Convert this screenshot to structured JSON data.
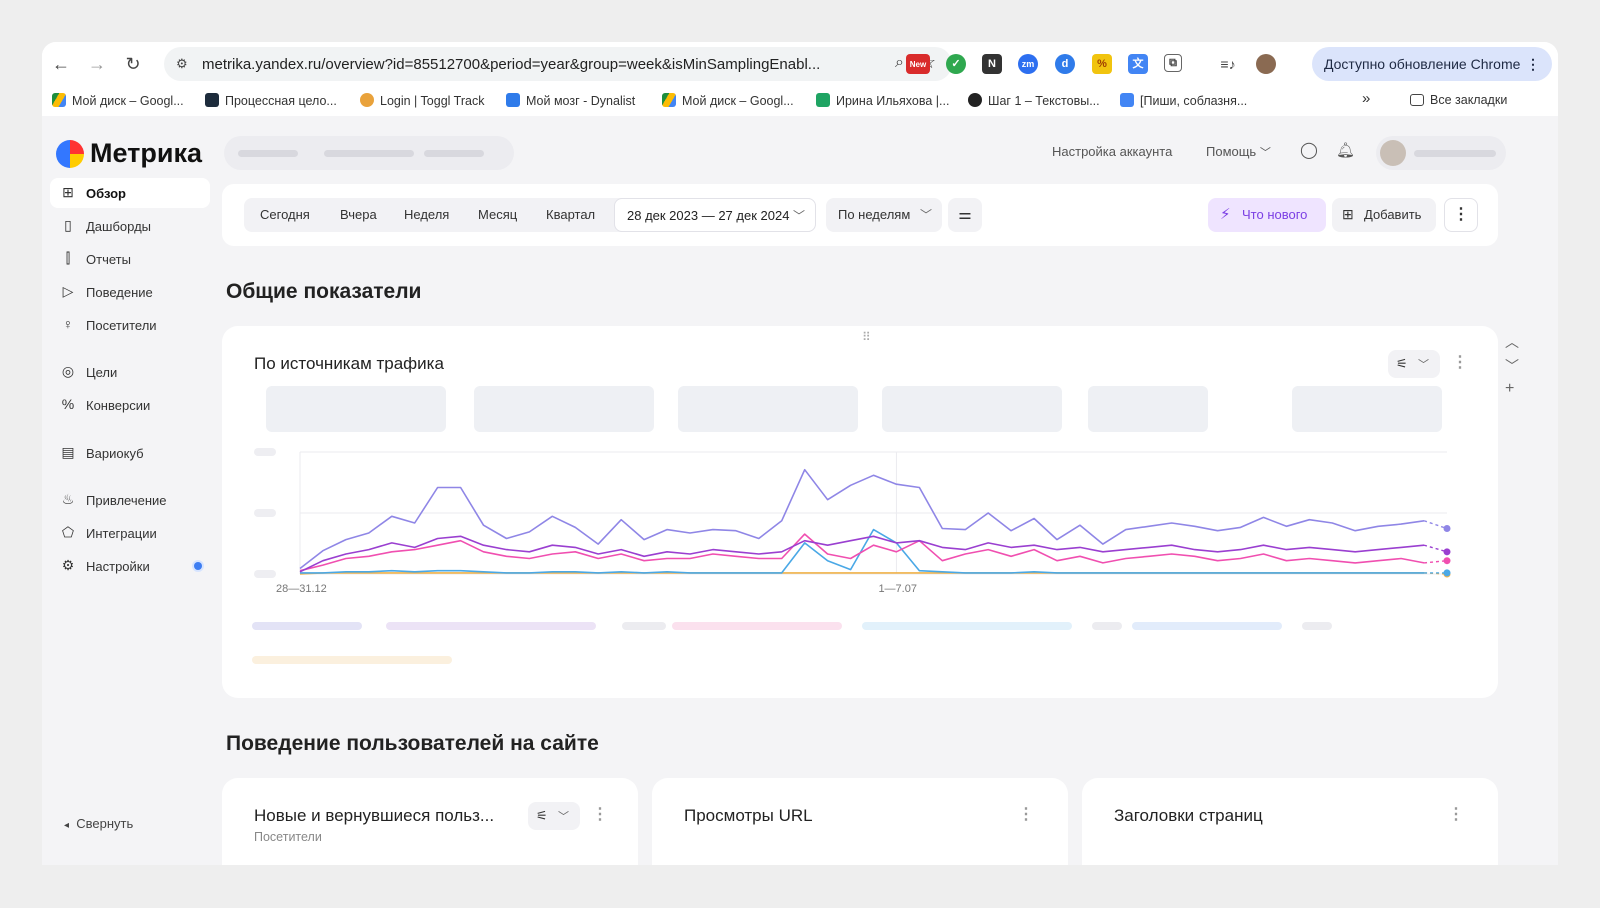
{
  "browser": {
    "url": "metrika.yandex.ru/overview?id=85512700&period=year&group=week&isMinSamplingEnabl...",
    "update_label": "Доступно обновление Chrome",
    "extensions": [
      "toggl-new-icon",
      "chrome-check-icon",
      "notion-icon",
      "zoom-icon",
      "dynalist-icon",
      "percent-icon",
      "translate-icon",
      "puzzle-icon",
      "media-icon",
      "profile-avatar-icon"
    ],
    "new_badge": "New",
    "bookmarks": [
      "Мой диск – Googl...",
      "Процессная цело...",
      "Login | Toggl Track",
      "Мой мозг - Dynalist",
      "Мой диск – Googl...",
      "Ирина Ильяхова |...",
      "Шаг 1 – Текстовы...",
      "[Пиши, соблазня..."
    ],
    "bookmarks_more": "»",
    "all_bookmarks": "Все закладки"
  },
  "header": {
    "logo": "Метрика",
    "account_settings": "Настройка аккаунта",
    "help": "Помощь"
  },
  "sidebar": {
    "items": [
      {
        "label": "Обзор",
        "icon": "grid-icon",
        "glyph": "⊞"
      },
      {
        "label": "Дашборды",
        "icon": "dashboards-icon",
        "glyph": "▯"
      },
      {
        "label": "Отчеты",
        "icon": "reports-icon",
        "glyph": "⫿"
      },
      {
        "label": "Поведение",
        "icon": "play-icon",
        "glyph": "▷"
      },
      {
        "label": "Посетители",
        "icon": "person-icon",
        "glyph": "♀"
      },
      {
        "label": "Цели",
        "icon": "target-icon",
        "glyph": "◎"
      },
      {
        "label": "Конверсии",
        "icon": "percent-icon",
        "glyph": "%"
      },
      {
        "label": "Вариокуб",
        "icon": "cube-icon",
        "glyph": "▤"
      },
      {
        "label": "Привлечение",
        "icon": "flame-icon",
        "glyph": "♨"
      },
      {
        "label": "Интеграции",
        "icon": "integration-icon",
        "glyph": "⬠"
      },
      {
        "label": "Настройки",
        "icon": "gear-icon",
        "glyph": "⚙"
      }
    ],
    "collapse": "Свернуть"
  },
  "filters": {
    "periods": [
      "Сегодня",
      "Вчера",
      "Неделя",
      "Месяц",
      "Квартал"
    ],
    "date_range": "28 дек 2023 — 27 дек 2024",
    "group_by": "По неделям",
    "whats_new": "Что нового",
    "add": "Добавить"
  },
  "sections": {
    "general": "Общие показатели",
    "behavior": "Поведение пользователей на сайте"
  },
  "traffic_card": {
    "title": "По источникам трафика",
    "x_ticks": [
      "28—31.12",
      "1—7.07"
    ]
  },
  "behavior_cards": [
    {
      "title": "Новые и вернувшиеся польз...",
      "subtitle": "Посетители"
    },
    {
      "title": "Просмотры URL",
      "subtitle": ""
    },
    {
      "title": "Заголовки страниц",
      "subtitle": ""
    }
  ],
  "colors": {
    "purple": "#8f86e6",
    "violet": "#9a3fd0",
    "pink": "#f04fb0",
    "blue": "#4aa8e6",
    "orange": "#f0b24a",
    "green": "#5fcf7f",
    "accent": "#7b3fe4"
  },
  "chart_data": {
    "type": "line",
    "title": "По источникам трафика",
    "xlabel": "",
    "ylabel": "",
    "x_ticks_visible": [
      "28—31.12",
      "1—7.07"
    ],
    "grid": true,
    "series": [
      {
        "color": "#8f86e6",
        "values": [
          5,
          21,
          31,
          37,
          52,
          46,
          78,
          78,
          44,
          32,
          38,
          52,
          42,
          27,
          49,
          31,
          40,
          37,
          40,
          39,
          32,
          48,
          94,
          67,
          80,
          89,
          81,
          78,
          41,
          40,
          55,
          39,
          50,
          31,
          44,
          27,
          40,
          43,
          46,
          43,
          39,
          42,
          51,
          43,
          49,
          46,
          39,
          43,
          45,
          48,
          41
        ]
      },
      {
        "color": "#9a3fd0",
        "values": [
          2,
          12,
          18,
          22,
          28,
          24,
          32,
          34,
          26,
          22,
          20,
          26,
          24,
          18,
          22,
          16,
          20,
          18,
          22,
          20,
          18,
          20,
          30,
          26,
          30,
          34,
          28,
          30,
          24,
          22,
          28,
          24,
          26,
          22,
          24,
          20,
          22,
          24,
          26,
          22,
          20,
          22,
          26,
          22,
          24,
          22,
          20,
          22,
          24,
          26,
          20
        ]
      },
      {
        "color": "#f04fb0",
        "values": [
          3,
          8,
          14,
          16,
          20,
          22,
          26,
          30,
          20,
          16,
          14,
          18,
          20,
          14,
          18,
          12,
          14,
          14,
          18,
          16,
          14,
          14,
          36,
          18,
          14,
          26,
          20,
          30,
          12,
          18,
          22,
          16,
          22,
          12,
          16,
          10,
          14,
          16,
          18,
          16,
          12,
          14,
          18,
          12,
          14,
          12,
          10,
          12,
          14,
          10,
          12
        ]
      },
      {
        "color": "#4aa8e6",
        "values": [
          1,
          1,
          2,
          2,
          3,
          2,
          3,
          3,
          2,
          1,
          1,
          2,
          2,
          1,
          2,
          1,
          2,
          1,
          1,
          1,
          1,
          1,
          28,
          12,
          4,
          40,
          28,
          3,
          2,
          1,
          1,
          1,
          2,
          1,
          1,
          1,
          1,
          1,
          1,
          1,
          1,
          1,
          1,
          1,
          1,
          1,
          1,
          1,
          1,
          1,
          1
        ]
      },
      {
        "color": "#f0b24a",
        "values": [
          0,
          1,
          1,
          1,
          1,
          1,
          1,
          1,
          1,
          1,
          1,
          1,
          1,
          1,
          1,
          1,
          1,
          1,
          1,
          1,
          1,
          1,
          1,
          1,
          1,
          1,
          1,
          1,
          1,
          1,
          1,
          1,
          1,
          1,
          1,
          1,
          1,
          1,
          1,
          1,
          1,
          1,
          1,
          1,
          1,
          1,
          1,
          1,
          1,
          1,
          0
        ]
      }
    ],
    "ylim": [
      0,
      110
    ]
  }
}
